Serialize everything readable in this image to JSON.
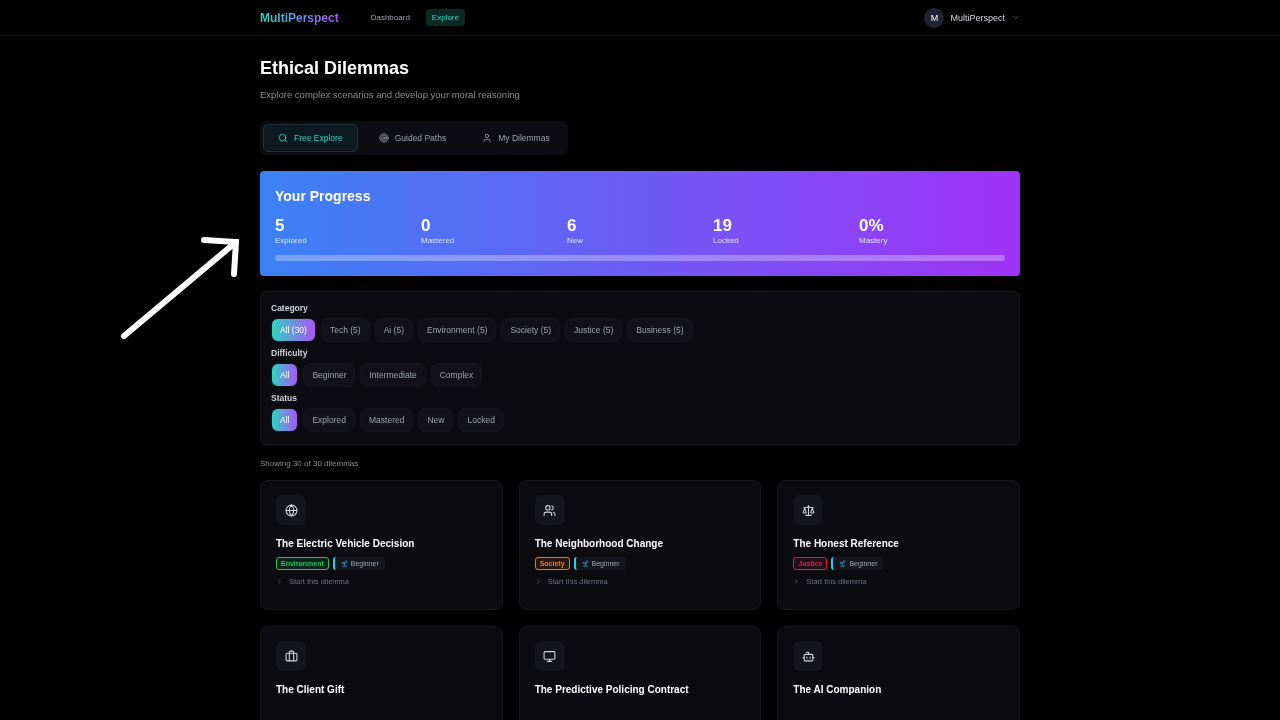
{
  "nav": {
    "brand": "MultiPerspect",
    "links": [
      {
        "label": "Dashboard",
        "selected": false
      },
      {
        "label": "Explore",
        "selected": true
      }
    ],
    "user": {
      "initial": "M",
      "name": "MultiPerspect"
    }
  },
  "header": {
    "title": "Ethical Dilemmas",
    "subtitle": "Explore complex scenarios and develop your moral reasoning"
  },
  "tabs": [
    {
      "label": "Free Explore",
      "selected": true
    },
    {
      "label": "Guided Paths",
      "selected": false
    },
    {
      "label": "My Dilemmas",
      "selected": false
    }
  ],
  "progress": {
    "title": "Your Progress",
    "stats": [
      {
        "value": "5",
        "label": "Explored"
      },
      {
        "value": "0",
        "label": "Mastered"
      },
      {
        "value": "6",
        "label": "New"
      },
      {
        "value": "19",
        "label": "Locked"
      },
      {
        "value": "0%",
        "label": "Mastery"
      }
    ],
    "level": 0
  },
  "filters": [
    {
      "label": "Category",
      "options": [
        {
          "label": "All (30)",
          "selected": true
        },
        {
          "label": "Tech (5)",
          "selected": false
        },
        {
          "label": "Ai (5)",
          "selected": false
        },
        {
          "label": "Environment (5)",
          "selected": false
        },
        {
          "label": "Society (5)",
          "selected": false
        },
        {
          "label": "Justice (5)",
          "selected": false
        },
        {
          "label": "Business (5)",
          "selected": false
        }
      ]
    },
    {
      "label": "Difficulty",
      "options": [
        {
          "label": "All",
          "selected": true
        },
        {
          "label": "Beginner",
          "selected": false
        },
        {
          "label": "Intermediate",
          "selected": false
        },
        {
          "label": "Complex",
          "selected": false
        }
      ]
    },
    {
      "label": "Status",
      "options": [
        {
          "label": "All",
          "selected": true
        },
        {
          "label": "Explored",
          "selected": false
        },
        {
          "label": "Mastered",
          "selected": false
        },
        {
          "label": "New",
          "selected": false
        },
        {
          "label": "Locked",
          "selected": false
        }
      ]
    }
  ],
  "count": "Showing 30 of 30 dilemmas",
  "cards": [
    {
      "title": "The Electric Vehicle Decision",
      "category": "Environment",
      "color": "#22c55e",
      "difficulty": "Beginner",
      "action": "Start this dilemma"
    },
    {
      "title": "The Neighborhood Change",
      "category": "Society",
      "color": "#f97316",
      "difficulty": "Beginner",
      "action": "Start this dilemma"
    },
    {
      "title": "The Honest Reference",
      "category": "Justice",
      "color": "#e11d48",
      "difficulty": "Beginner",
      "action": "Start this dilemma"
    },
    {
      "title": "The Client Gift"
    },
    {
      "title": "The Predictive Policing Contract"
    },
    {
      "title": "The AI Companion"
    }
  ]
}
